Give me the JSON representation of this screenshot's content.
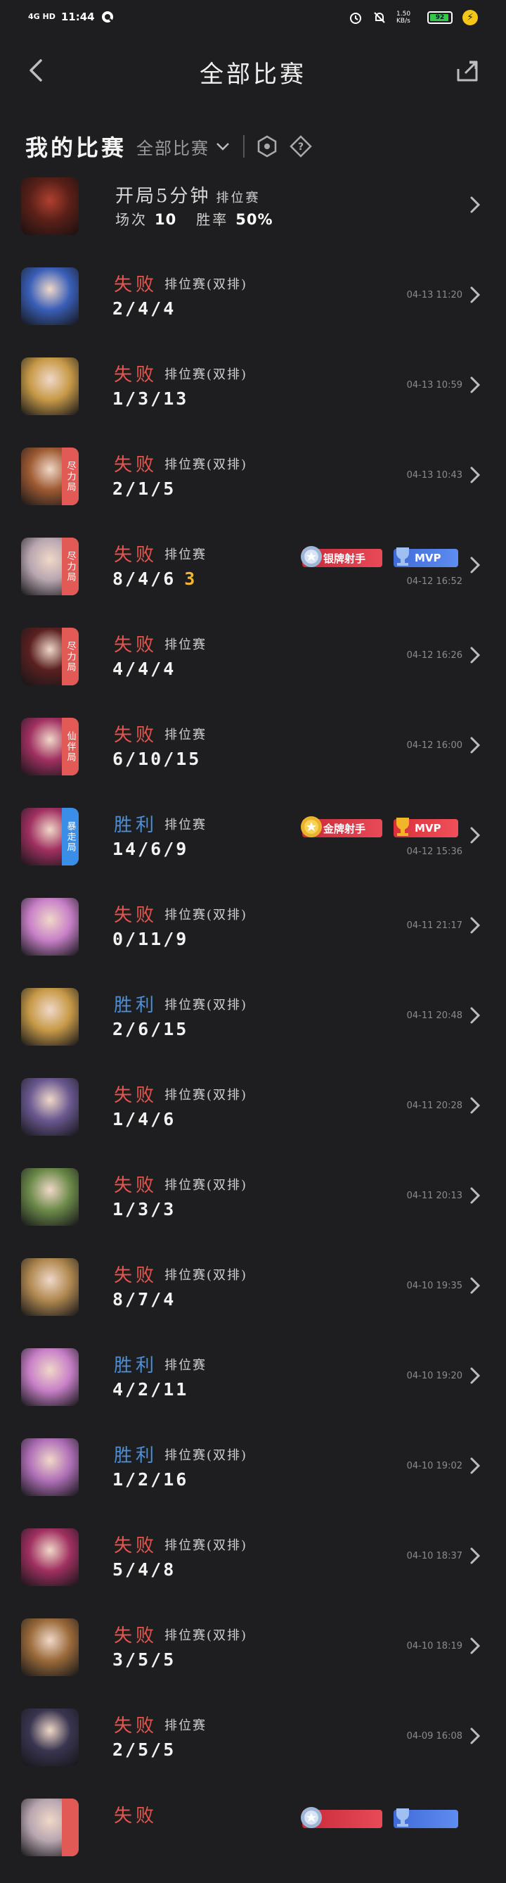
{
  "status_bar": {
    "network": "4G HD",
    "time": "11:44",
    "speed": "1.50 KB/s",
    "battery": "92"
  },
  "header": {
    "title": "全部比赛"
  },
  "filter": {
    "my_matches": "我的比赛",
    "selected": "全部比赛"
  },
  "summary": {
    "title": "开局5分钟",
    "mode": "排位赛",
    "games_label": "场次",
    "games": "10",
    "winrate_label": "胜率",
    "winrate": "50%"
  },
  "matches": [
    {
      "result": "失败",
      "outcome": "loss",
      "mode": "排位赛(双排)",
      "kda": "2/4/4",
      "time": "04-13 11:20",
      "color": "#3a5fb8"
    },
    {
      "result": "失败",
      "outcome": "loss",
      "mode": "排位赛(双排)",
      "kda": "1/3/13",
      "time": "04-13 10:59",
      "color": "#c79a48"
    },
    {
      "result": "失败",
      "outcome": "loss",
      "mode": "排位赛(双排)",
      "kda": "2/1/5",
      "time": "04-13 10:43",
      "tag": "尽力局",
      "tag_color": "#e25a55",
      "color": "#9e5a32"
    },
    {
      "result": "失败",
      "outcome": "loss",
      "mode": "排位赛",
      "kda": "8/4/6",
      "extra": "3",
      "time": "04-12 16:52",
      "tag": "尽力局",
      "tag_color": "#e25a55",
      "badges": {
        "honor": "银牌射手",
        "mvp": "MVP",
        "mvp_kind": "silver"
      },
      "color": "#b8a6b0"
    },
    {
      "result": "失败",
      "outcome": "loss",
      "mode": "排位赛",
      "kda": "4/4/4",
      "time": "04-12 16:26",
      "tag": "尽力局",
      "tag_color": "#e25a55",
      "color": "#5a2020"
    },
    {
      "result": "失败",
      "outcome": "loss",
      "mode": "排位赛",
      "kda": "6/10/15",
      "time": "04-12 16:00",
      "tag": "仙伴局",
      "tag_color": "#e25a55",
      "color": "#a03060"
    },
    {
      "result": "胜利",
      "outcome": "win",
      "mode": "排位赛",
      "kda": "14/6/9",
      "time": "04-12 15:36",
      "tag": "暴走局",
      "tag_color": "#3b8ee8",
      "badges": {
        "honor": "金牌射手",
        "mvp": "MVP",
        "mvp_kind": "gold"
      },
      "color": "#a03060"
    },
    {
      "result": "失败",
      "outcome": "loss",
      "mode": "排位赛(双排)",
      "kda": "0/11/9",
      "time": "04-11 21:17",
      "color": "#c880c8"
    },
    {
      "result": "胜利",
      "outcome": "win",
      "mode": "排位赛(双排)",
      "kda": "2/6/15",
      "time": "04-11 20:48",
      "color": "#c79a48"
    },
    {
      "result": "失败",
      "outcome": "loss",
      "mode": "排位赛(双排)",
      "kda": "1/4/6",
      "time": "04-11 20:28",
      "color": "#6a5890"
    },
    {
      "result": "失败",
      "outcome": "loss",
      "mode": "排位赛(双排)",
      "kda": "1/3/3",
      "time": "04-11 20:13",
      "color": "#6c8a4a"
    },
    {
      "result": "失败",
      "outcome": "loss",
      "mode": "排位赛(双排)",
      "kda": "8/7/4",
      "time": "04-10 19:35",
      "color": "#b08850"
    },
    {
      "result": "胜利",
      "outcome": "win",
      "mode": "排位赛",
      "kda": "4/2/11",
      "time": "04-10 19:20",
      "color": "#c880c8"
    },
    {
      "result": "胜利",
      "outcome": "win",
      "mode": "排位赛(双排)",
      "kda": "1/2/16",
      "time": "04-10 19:02",
      "color": "#b070b8"
    },
    {
      "result": "失败",
      "outcome": "loss",
      "mode": "排位赛(双排)",
      "kda": "5/4/8",
      "time": "04-10 18:37",
      "color": "#a03060"
    },
    {
      "result": "失败",
      "outcome": "loss",
      "mode": "排位赛(双排)",
      "kda": "3/5/5",
      "time": "04-10 18:19",
      "color": "#9a6a3a"
    },
    {
      "result": "失败",
      "outcome": "loss",
      "mode": "排位赛",
      "kda": "2/5/5",
      "time": "04-09 16:08",
      "color": "#3a3550"
    },
    {
      "result": "失败",
      "outcome": "loss",
      "mode": "",
      "kda": "",
      "time": "",
      "tag": "",
      "tag_color": "#e25a55",
      "partial": true,
      "badges": {
        "honor": "",
        "mvp": "",
        "mvp_kind": "silver"
      },
      "color": "#b8a6b0"
    }
  ]
}
